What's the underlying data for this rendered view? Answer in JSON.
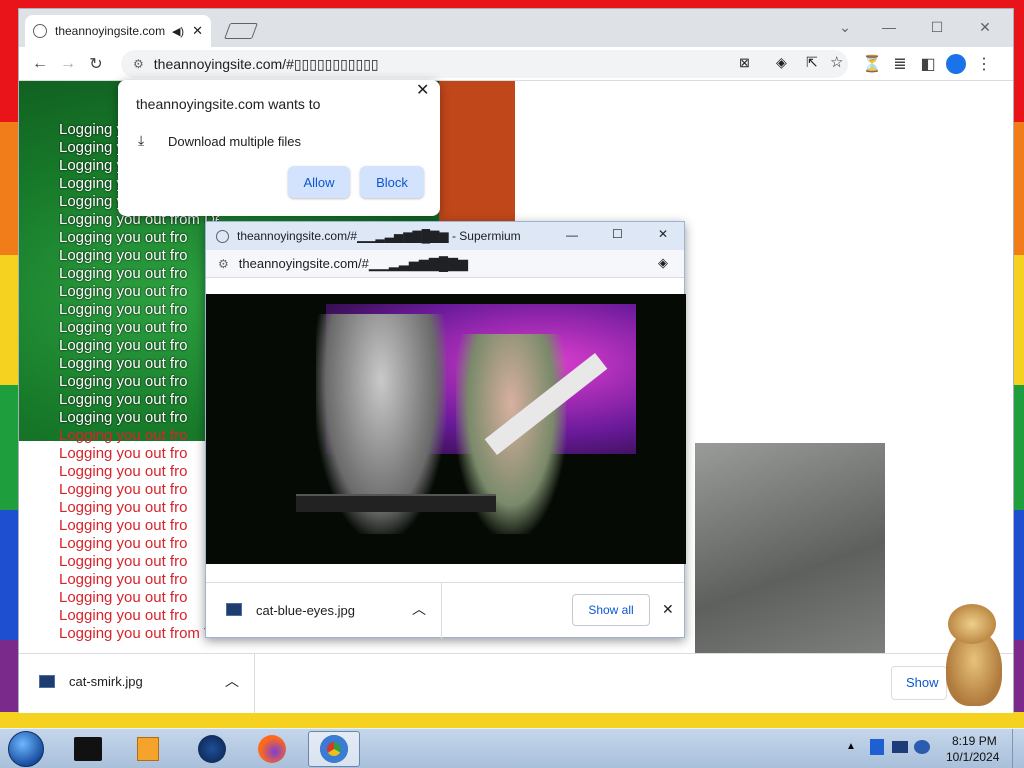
{
  "tab": {
    "title": "theannoyingsite.com"
  },
  "toolbar": {
    "url": "theannoyingsite.com/#▯▯▯▯▯▯▯▯▯▯▯"
  },
  "permission": {
    "header": "theannoyingsite.com wants to",
    "item": "Download multiple files",
    "allow": "Allow",
    "block": "Block"
  },
  "logging": {
    "fragment": "Logging you out fro",
    "fragment_long": "Logging you out from Deviantart",
    "fragment_last": "Logging you out from Tumblr",
    "white_count": 17,
    "red_count": 12
  },
  "popup": {
    "title": "theannoyingsite.com/#▁▁▂▃▅▆▇█▇▆ - Supermium",
    "url": "theannoyingsite.com/#▁▁▂▃▅▆▇█▇▆",
    "download_file": "cat-blue-eyes.jpg",
    "show_all": "Show all"
  },
  "download_bar": {
    "file": "cat-smirk.jpg",
    "show_all_partial": "Show"
  },
  "taskbar": {
    "time": "8:19 PM",
    "date": "10/1/2024"
  },
  "colors": {
    "accent": "#0b57d0",
    "button_bg": "#d3e3fd",
    "log_red": "#d8232a"
  }
}
